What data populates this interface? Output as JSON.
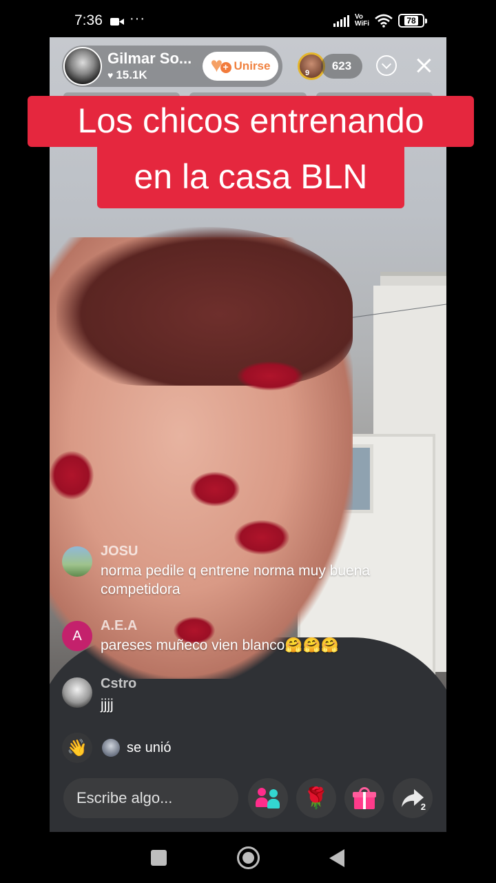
{
  "status_bar": {
    "time": "7:36",
    "dots": "···",
    "vowifi_top": "Vo",
    "vowifi_bottom": "WiFi",
    "battery": "78"
  },
  "host": {
    "name": "Gilmar So...",
    "likes": "15.1K",
    "join_label": "Unirse"
  },
  "viewers": {
    "top_badge": "9",
    "count": "623"
  },
  "caption": {
    "line1": "Los chicos entrenando",
    "line2": "en la casa BLN"
  },
  "comments": [
    {
      "user": "JOSU",
      "text": "norma pedile q entrene norma muy buena competidora"
    },
    {
      "user": "A.E.A",
      "avatar_letter": "A",
      "text": "pareses muñeco vien blanco🤗🤗🤗"
    },
    {
      "user": "Cstro",
      "text": "jjjj"
    }
  ],
  "joined": {
    "text": "se unió"
  },
  "bottom_bar": {
    "input_placeholder": "Escribe algo...",
    "share_count": "2"
  },
  "colors": {
    "caption_bg": "#e5273e",
    "join_text": "#f0813f",
    "multi_guest_pink": "#ff2d8b",
    "multi_guest_teal": "#33d6d0",
    "gift_pink": "#ff3b8a"
  },
  "icons": {
    "camera": "video-camera-icon",
    "wifi": "wifi-icon",
    "signal": "signal-bars-icon",
    "battery": "battery-icon",
    "heart": "heart-icon",
    "join": "heart-plus-icon",
    "chevron": "chevron-down-circle-icon",
    "close": "close-icon",
    "wave": "waving-hand-icon",
    "multi_guest": "multi-guest-icon",
    "rose": "rose-icon",
    "gift": "gift-icon",
    "share": "share-arrow-icon"
  }
}
